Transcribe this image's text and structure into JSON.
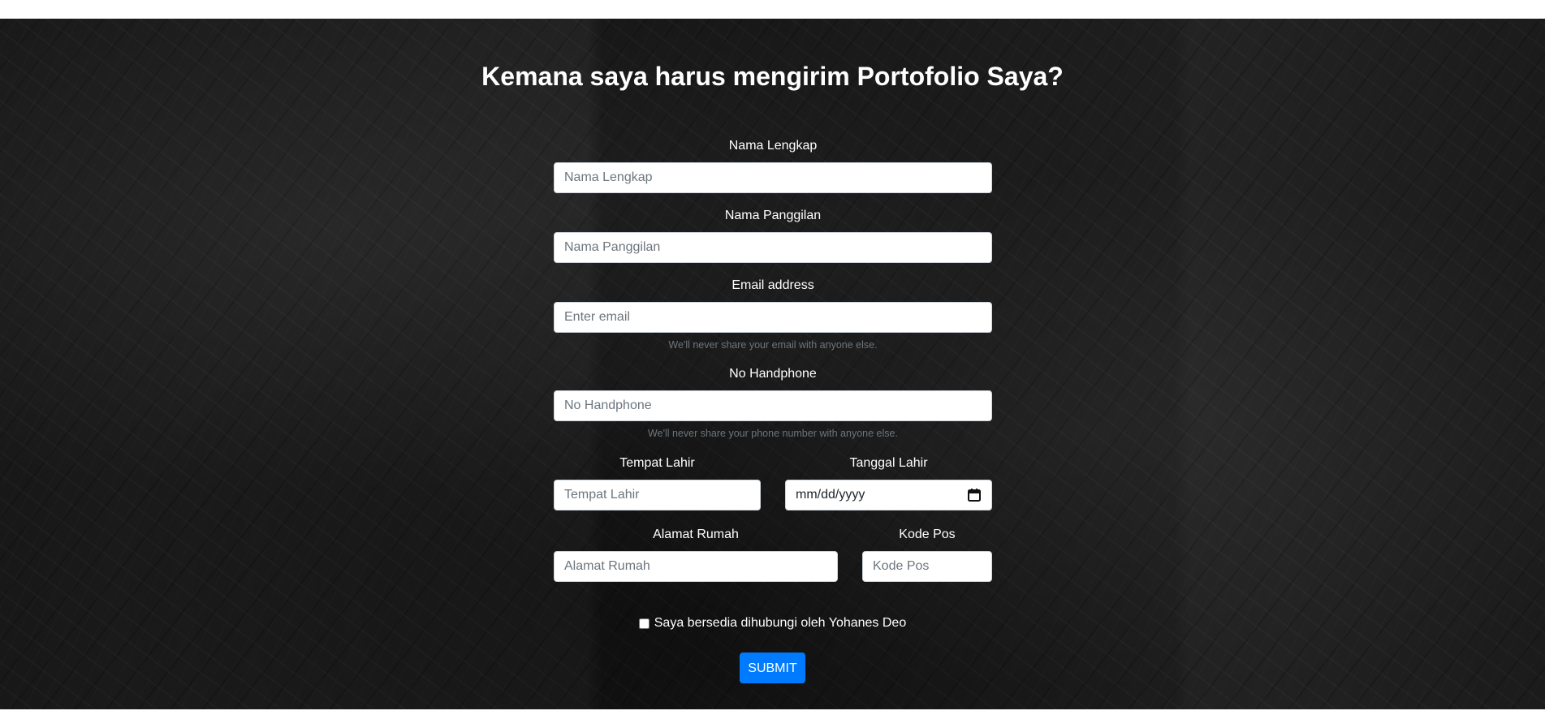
{
  "page_title": "Kemana saya harus mengirim Portofolio Saya?",
  "form": {
    "nama_lengkap": {
      "label": "Nama Lengkap",
      "placeholder": "Nama Lengkap",
      "value": ""
    },
    "nama_panggilan": {
      "label": "Nama Panggilan",
      "placeholder": "Nama Panggilan",
      "value": ""
    },
    "email": {
      "label": "Email address",
      "placeholder": "Enter email",
      "value": "",
      "help": "We'll never share your email with anyone else."
    },
    "no_handphone": {
      "label": "No Handphone",
      "placeholder": "No Handphone",
      "value": "",
      "help": "We'll never share your phone number with anyone else."
    },
    "tempat_lahir": {
      "label": "Tempat Lahir",
      "placeholder": "Tempat Lahir",
      "value": ""
    },
    "tanggal_lahir": {
      "label": "Tanggal Lahir",
      "placeholder": "mm/dd/yyyy",
      "icon": "calendar-icon"
    },
    "alamat_rumah": {
      "label": "Alamat Rumah",
      "placeholder": "Alamat Rumah",
      "value": ""
    },
    "kode_pos": {
      "label": "Kode Pos",
      "placeholder": "Kode Pos",
      "value": ""
    },
    "consent": {
      "label": "Saya bersedia dihubungi oleh Yohanes Deo",
      "checked": false
    },
    "submit_label": "SUBMIT"
  },
  "colors": {
    "accent": "#007bff",
    "background": "#1c1c1c",
    "text": "#ffffff",
    "help_text": "#6c757d"
  }
}
